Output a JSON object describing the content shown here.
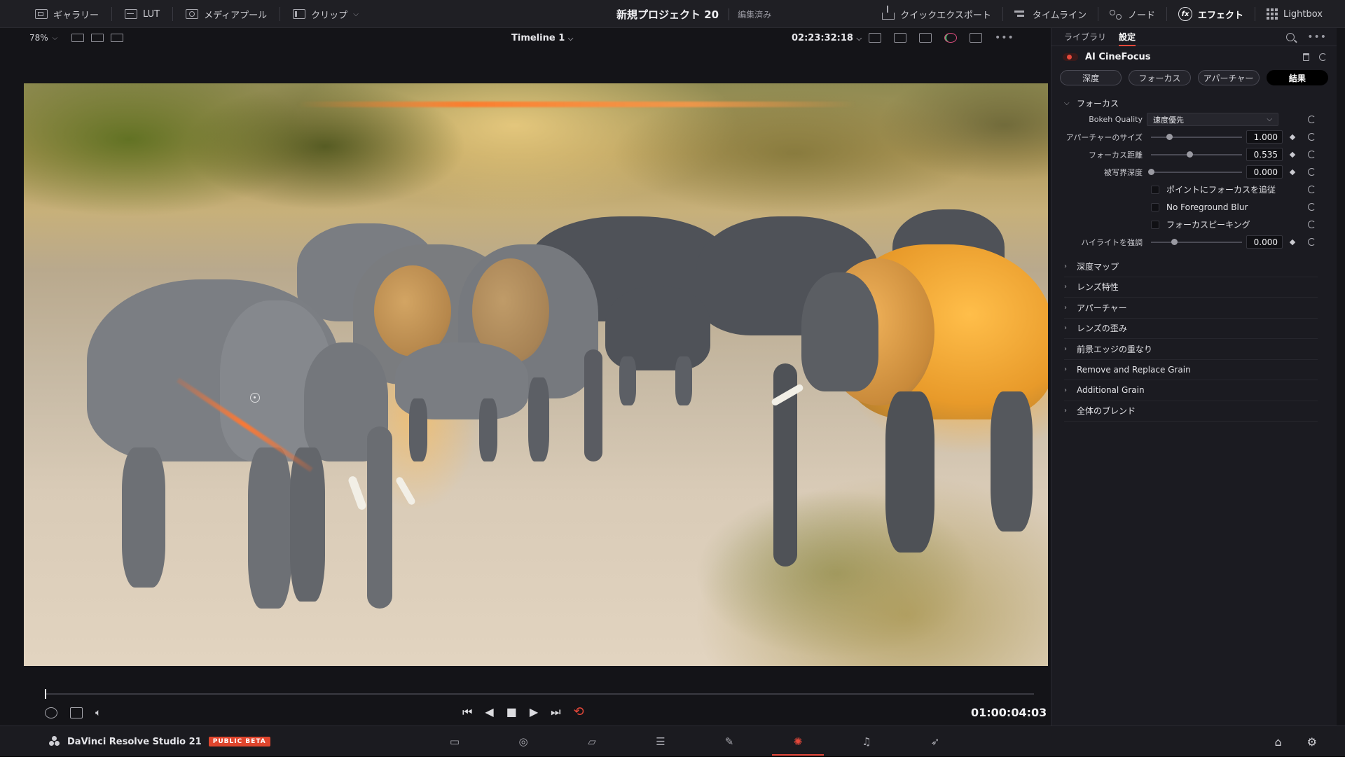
{
  "topbar": {
    "left_buttons": [
      {
        "label": "ギャラリー",
        "icon": "gallery-icon"
      },
      {
        "label": "LUT",
        "icon": "lut-icon"
      },
      {
        "label": "メディアプール",
        "icon": "media-pool-icon"
      },
      {
        "label": "クリップ",
        "icon": "clips-icon"
      }
    ],
    "project_title": "新規プロジェクト 20",
    "project_status": "編集済み",
    "right_buttons": [
      {
        "label": "クイックエクスポート",
        "icon": "export-icon"
      },
      {
        "label": "タイムライン",
        "icon": "timeline-icon"
      },
      {
        "label": "ノード",
        "icon": "nodes-icon"
      },
      {
        "label": "エフェクト",
        "icon": "effects-icon"
      },
      {
        "label": "Lightbox",
        "icon": "lightbox-icon"
      }
    ]
  },
  "viewer": {
    "zoom": "78%",
    "timeline_name": "Timeline 1",
    "source_timecode": "02:23:32:18",
    "record_timecode": "01:00:04:03",
    "playhead_fraction": 0.0
  },
  "panel": {
    "tabs": [
      "ライブラリ",
      "設定"
    ],
    "active_tab": "設定",
    "effect_name": "AI CineFocus",
    "effect_enabled": true,
    "seg_tabs": [
      "深度",
      "フォーカス",
      "アパーチャー",
      "結果"
    ],
    "active_seg": "結果",
    "focus_section": {
      "title": "フォーカス",
      "bokeh_label": "Bokeh Quality",
      "bokeh_value": "速度優先",
      "params": [
        {
          "label": "アパーチャーのサイズ",
          "value": "1.000",
          "level": 0.2
        },
        {
          "label": "フォーカス距離",
          "value": "0.535",
          "level": 0.42
        },
        {
          "label": "被写界深度",
          "value": "0.000",
          "level": 0.0
        }
      ],
      "checkboxes": [
        "ポイントにフォーカスを追従",
        "No Foreground Blur",
        "フォーカスピーキング"
      ],
      "highlight": {
        "label": "ハイライトを強調",
        "value": "0.000",
        "level": 0.25
      }
    },
    "collapsed_sections": [
      "深度マップ",
      "レンズ特性",
      "アパーチャー",
      "レンズの歪み",
      "前景エッジの重なり",
      "Remove and Replace Grain",
      "Additional Grain",
      "全体のブレンド"
    ]
  },
  "bottombar": {
    "app_name": "DaVinci Resolve Studio 21",
    "badge": "PUBLIC BETA",
    "pages": [
      "media-page-icon",
      "cut-page-icon",
      "edit-page-icon",
      "fusion-page-icon",
      "color-page-icon",
      "fairlight-page-icon",
      "deliver-page-icon",
      "home-icon"
    ],
    "active_page": "color-page-icon"
  },
  "colors": {
    "accent": "#e5483a",
    "panel_bg": "#1b1b21",
    "topbar_bg": "#1f1f24"
  }
}
